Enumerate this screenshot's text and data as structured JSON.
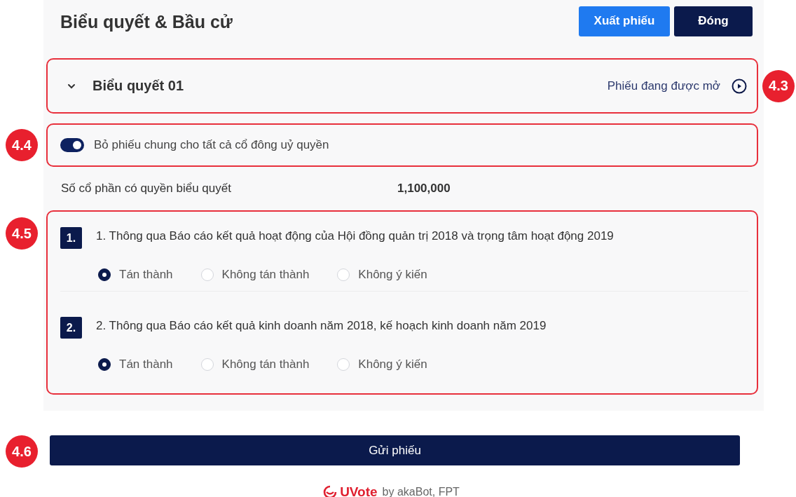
{
  "header": {
    "title": "Biểu quyết & Bầu cử",
    "buttons": [
      {
        "label": "Xuất phiếu",
        "kind": "primary"
      },
      {
        "label": "Đóng",
        "kind": "dark"
      }
    ]
  },
  "ballot": {
    "callout": "4.3",
    "expanded": true,
    "title": "Biểu quyết 01",
    "status": "Phiếu đang được mở"
  },
  "proxy_vote": {
    "callout": "4.4",
    "on": true,
    "label": "Bỏ phiếu chung cho tất cả cổ đông uỷ quyền"
  },
  "shares": {
    "label": "Số cổ phần có quyền biểu quyết",
    "value": "1,100,000"
  },
  "questions_callout": "4.5",
  "questions": [
    {
      "number": "1.",
      "text": "1. Thông qua Báo cáo kết quả hoạt động của Hội đồng quản trị 2018 và trọng tâm hoạt động 2019",
      "options": [
        {
          "label": "Tán thành",
          "selected": true
        },
        {
          "label": "Không tán thành",
          "selected": false
        },
        {
          "label": "Không ý kiến",
          "selected": false
        }
      ]
    },
    {
      "number": "2.",
      "text": "2. Thông qua Báo cáo kết quả kinh doanh năm 2018, kế hoạch kinh doanh năm 2019",
      "options": [
        {
          "label": "Tán thành",
          "selected": true
        },
        {
          "label": "Không tán thành",
          "selected": false
        },
        {
          "label": "Không ý kiến",
          "selected": false
        }
      ]
    }
  ],
  "submit": {
    "callout": "4.6",
    "label": "Gửi phiếu"
  },
  "footer": {
    "brand": "UVote",
    "credit": "by akaBot, FPT"
  }
}
